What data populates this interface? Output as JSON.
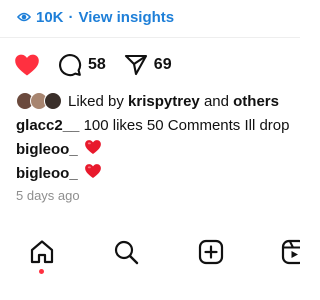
{
  "insights": {
    "views": "10K",
    "separator": "·",
    "link_label": "View insights",
    "eye_icon": "eye-icon"
  },
  "actions": {
    "like_icon": "heart-filled-icon",
    "comment_icon": "comment-bubble-icon",
    "comment_count": "58",
    "share_icon": "paper-plane-icon",
    "share_count": "69"
  },
  "likes": {
    "prefix": "Liked by",
    "user": "krispytrey",
    "conjunction": "and",
    "others": "others"
  },
  "caption": {
    "username": "glacc2__",
    "text": "100 likes 50 Comments Ill drop"
  },
  "comments": [
    {
      "username": "bigleoo_",
      "emoji_icon": "red-heart-emoji"
    },
    {
      "username": "bigleoo_",
      "emoji_icon": "red-heart-emoji"
    }
  ],
  "timestamp": "5 days ago",
  "bottom_nav": {
    "items": [
      "home-icon",
      "search-icon",
      "create-post-icon",
      "reels-icon"
    ],
    "active": "home-icon"
  },
  "colors": {
    "accent": "#1e7fd8",
    "like_red": "#ff3040",
    "text": "#111111",
    "muted": "#8e8e8e"
  }
}
